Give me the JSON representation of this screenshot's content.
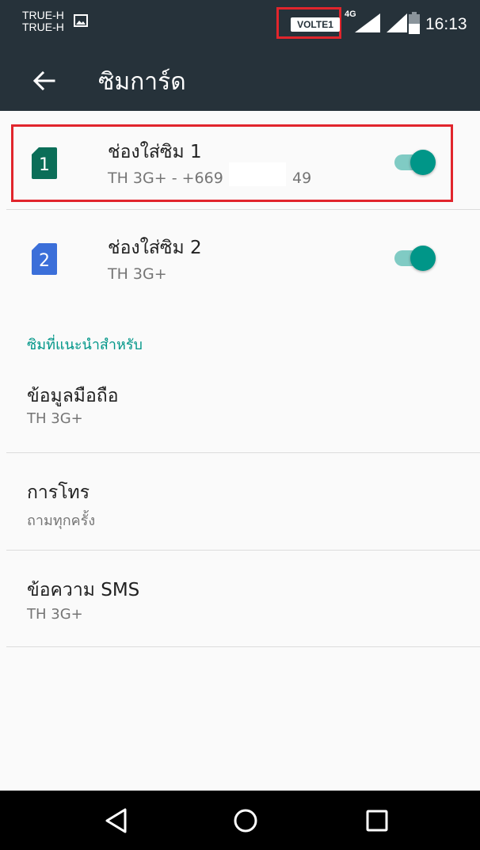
{
  "status_bar": {
    "carrier_1": "TRUE-H",
    "carrier_2": "TRUE-H",
    "volte_label": "VOLTE1",
    "network_type": "4G",
    "time": "16:13"
  },
  "toolbar": {
    "title": "ซิมการ์ด"
  },
  "sim_slots": [
    {
      "badge": "1",
      "title": "ช่องใส่ซิม 1",
      "subtitle_start": "TH 3G+ - +669",
      "subtitle_end": "49",
      "enabled": true,
      "color": "#0b6e58"
    },
    {
      "badge": "2",
      "title": "ช่องใส่ซิม 2",
      "subtitle": "TH 3G+",
      "enabled": true,
      "color": "#3b6fd9"
    }
  ],
  "preferred": {
    "header": "ซิมที่แนะนำสำหรับ",
    "items": [
      {
        "title": "ข้อมูลมือถือ",
        "value": "TH 3G+"
      },
      {
        "title": "การโทร",
        "value": "ถามทุกครั้ง"
      },
      {
        "title": "ข้อความ SMS",
        "value": "TH 3G+"
      }
    ]
  },
  "colors": {
    "accent": "#009688",
    "toolbar": "#26323a",
    "highlight": "#e1252c"
  },
  "icons": [
    "image-icon",
    "signal-icon",
    "battery-icon",
    "back-arrow-icon",
    "sim-card-icon",
    "nav-back-icon",
    "nav-home-icon",
    "nav-recents-icon"
  ]
}
